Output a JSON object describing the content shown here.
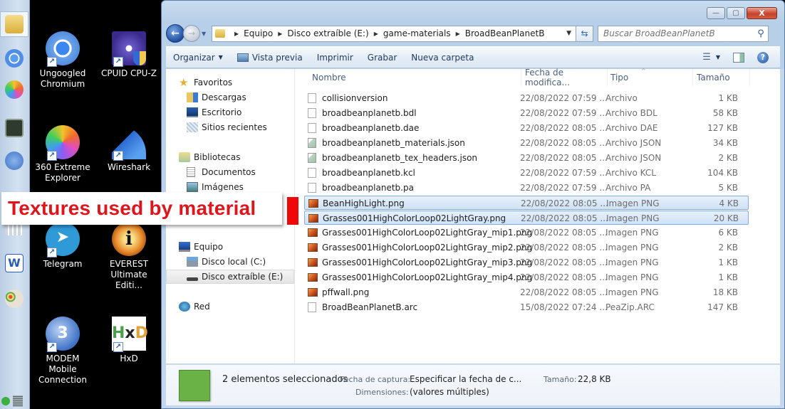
{
  "taskbar": {
    "items": [
      {
        "name": "windows-explorer",
        "color": "#e9c660"
      },
      {
        "name": "ungoogled-chromium",
        "color": "#4f8ee6"
      },
      {
        "name": "360-extreme-explorer",
        "color": "#e86bbd"
      },
      {
        "name": "terminal",
        "color": "#2f3a2f"
      },
      {
        "name": "modem-mobile",
        "color": "#3f72c6"
      },
      {
        "name": "calendar",
        "color": "#d9d9d9"
      },
      {
        "name": "word",
        "color": "#2b5fb4"
      },
      {
        "name": "paint",
        "color": "#e2a35c"
      }
    ]
  },
  "desktop": {
    "icons": [
      {
        "label_line1": "Ungoogled",
        "label_line2": "Chromium",
        "icon": "chromium-icon",
        "color": "#4f8ee6"
      },
      {
        "label_line1": "CPUID CPU-Z",
        "label_line2": "",
        "icon": "cpu-z-icon",
        "color": "#3a2a8c"
      },
      {
        "label_line1": "360 Extreme",
        "label_line2": "Explorer",
        "icon": "360-explorer-icon",
        "color": "#e86bbd"
      },
      {
        "label_line1": "Wireshark",
        "label_line2": "",
        "icon": "wireshark-icon",
        "color": "#2a6ad1"
      },
      {
        "label_line1": "Telegram",
        "label_line2": "",
        "icon": "telegram-icon",
        "color": "#2e9ad8"
      },
      {
        "label_line1": "EVEREST",
        "label_line2": "Ultimate Editi...",
        "icon": "everest-icon",
        "color": "#d6621c"
      },
      {
        "label_line1": "MODEM Mobile",
        "label_line2": "Connection",
        "icon": "modem-icon",
        "color": "#3f72c6"
      },
      {
        "label_line1": "HxD",
        "label_line2": "",
        "icon": "hxd-icon",
        "color": "#e0a23a"
      }
    ]
  },
  "window": {
    "caption": {
      "minimize": "—",
      "maximize": "▢",
      "close": "X"
    },
    "address": {
      "crumbs": [
        "Equipo",
        "Disco extraíble (E:)",
        "game-materials",
        "BroadBeanPlanetB"
      ]
    },
    "search": {
      "placeholder": "Buscar BroadBeanPlanetB"
    },
    "toolbar": {
      "organize": "Organizar",
      "preview": "Vista previa",
      "print": "Imprimir",
      "burn": "Grabar",
      "new_folder": "Nueva carpeta"
    },
    "navpane": {
      "favorites": "Favoritos",
      "downloads": "Descargas",
      "desktop": "Escritorio",
      "recent": "Sitios recientes",
      "libraries": "Bibliotecas",
      "documents": "Documentos",
      "images": "Imágenes",
      "computer": "Equipo",
      "local_disk": "Disco local (C:)",
      "removable": "Disco extraíble (E:)",
      "network": "Red"
    },
    "columns": {
      "name": "Nombre",
      "date": "Fecha de modifica...",
      "type": "Tipo",
      "size": "Tamaño"
    },
    "files": [
      {
        "name": "collisionversion",
        "date": "22/08/2022 07:59 ...",
        "type": "Archivo",
        "size": "1 KB",
        "icon": "generic",
        "selected": false
      },
      {
        "name": "broadbeanplanetb.bdl",
        "date": "22/08/2022 07:59 ...",
        "type": "Archivo BDL",
        "size": "58 KB",
        "icon": "generic",
        "selected": false
      },
      {
        "name": "broadbeanplanetb.dae",
        "date": "22/08/2022 08:05 ...",
        "type": "Archivo DAE",
        "size": "127 KB",
        "icon": "generic",
        "selected": false
      },
      {
        "name": "broadbeanplanetb_materials.json",
        "date": "22/08/2022 08:05 ...",
        "type": "Archivo JSON",
        "size": "34 KB",
        "icon": "json",
        "selected": false
      },
      {
        "name": "broadbeanplanetb_tex_headers.json",
        "date": "22/08/2022 08:05 ...",
        "type": "Archivo JSON",
        "size": "2 KB",
        "icon": "json",
        "selected": false
      },
      {
        "name": "broadbeanplanetb.kcl",
        "date": "22/08/2022 07:59 ...",
        "type": "Archivo KCL",
        "size": "104 KB",
        "icon": "generic",
        "selected": false
      },
      {
        "name": "broadbeanplanetb.pa",
        "date": "22/08/2022 07:59 ...",
        "type": "Archivo PA",
        "size": "5 KB",
        "icon": "generic",
        "selected": false
      },
      {
        "name": "BeanHighLight.png",
        "date": "22/08/2022 08:05 ...",
        "type": "Imagen PNG",
        "size": "4 KB",
        "icon": "png",
        "selected": true
      },
      {
        "name": "Grasses001HighColorLoop02LightGray.png",
        "date": "22/08/2022 08:05 ...",
        "type": "Imagen PNG",
        "size": "20 KB",
        "icon": "png",
        "selected": true
      },
      {
        "name": "Grasses001HighColorLoop02LightGray_mip1.png",
        "date": "22/08/2022 08:05 ...",
        "type": "Imagen PNG",
        "size": "6 KB",
        "icon": "png",
        "selected": false
      },
      {
        "name": "Grasses001HighColorLoop02LightGray_mip2.png",
        "date": "22/08/2022 08:05 ...",
        "type": "Imagen PNG",
        "size": "2 KB",
        "icon": "png",
        "selected": false
      },
      {
        "name": "Grasses001HighColorLoop02LightGray_mip3.png",
        "date": "22/08/2022 08:05 ...",
        "type": "Imagen PNG",
        "size": "1 KB",
        "icon": "png",
        "selected": false
      },
      {
        "name": "Grasses001HighColorLoop02LightGray_mip4.png",
        "date": "22/08/2022 08:05 ...",
        "type": "Imagen PNG",
        "size": "1 KB",
        "icon": "png",
        "selected": false
      },
      {
        "name": "pffwall.png",
        "date": "22/08/2022 08:05 ...",
        "type": "Imagen PNG",
        "size": "18 KB",
        "icon": "png",
        "selected": false
      },
      {
        "name": "BroadBeanPlanetB.arc",
        "date": "15/08/2022 07:24 ...",
        "type": "PeaZip.ARC",
        "size": "147 KB",
        "icon": "generic",
        "selected": false
      }
    ],
    "details": {
      "selection": "2 elementos seleccionados",
      "capture_label": "Fecha de captura:",
      "capture_value": "Especificar la fecha de c...",
      "size_label": "Tamaño:",
      "size_value": "22,8 KB",
      "dims_label": "Dimensiones:",
      "dims_value": "(valores múltiples)"
    }
  },
  "annotation": {
    "text": "Textures used by material",
    "color": "#e0141b"
  }
}
